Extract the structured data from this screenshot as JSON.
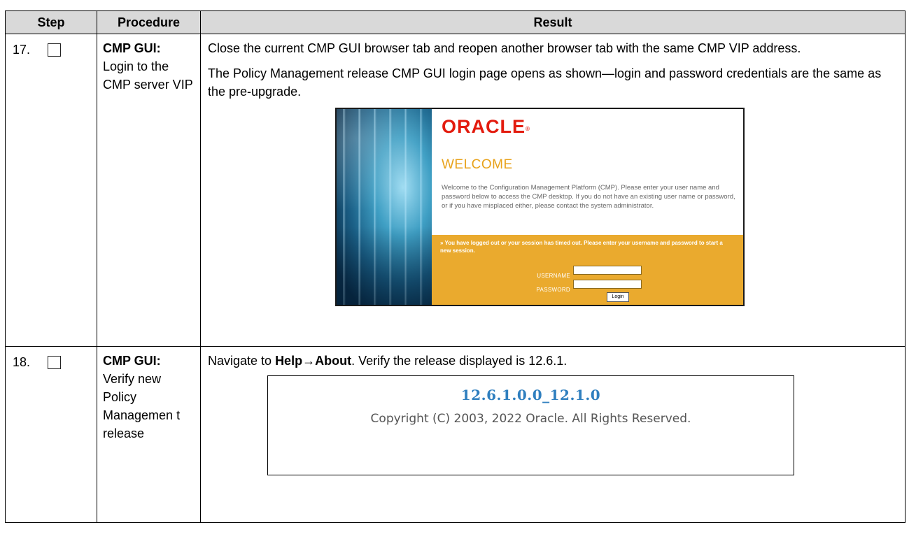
{
  "headers": {
    "step": "Step",
    "procedure": "Procedure",
    "result": "Result"
  },
  "rows": [
    {
      "step": "17.",
      "procedure_title": "CMP GUI:",
      "procedure_text": "Login to the CMP server VIP",
      "result_p1": "Close the current CMP GUI browser tab and reopen another browser tab with the same CMP VIP address.",
      "result_p2": "The Policy Management release CMP GUI login page opens as shown—login and password credentials are the same as the pre-upgrade.",
      "login_screen": {
        "logo": "ORACLE",
        "logo_mark": "®",
        "welcome": "WELCOME",
        "welcome_text": "Welcome to the Configuration Management Platform (CMP). Please enter your user name and password below to access the CMP desktop. If you do not have an existing user name or password, or if you have misplaced either, please contact the system administrator.",
        "session_msg": "» You have logged out or your session has timed out. Please enter your username and password to start a new session.",
        "username_label": "USERNAME",
        "password_label": "PASSWORD",
        "login_button": "Login",
        "accent_color": "#eaaa2e",
        "logo_color": "#e31b0e"
      }
    },
    {
      "step": "18.",
      "procedure_title": "CMP GUI:",
      "procedure_text": "Verify new Policy Managemen t release",
      "result_prefix": "Navigate to ",
      "result_help": "Help",
      "result_arrow": "→",
      "result_about": "About",
      "result_suffix": ". Verify the release displayed is 12.6.1.",
      "about_box": {
        "version": "12.6.1.0.0_12.1.0",
        "copyright": "Copyright (C) 2003, 2022 Oracle. All Rights Reserved.",
        "version_color": "#2f7fbf"
      }
    }
  ]
}
